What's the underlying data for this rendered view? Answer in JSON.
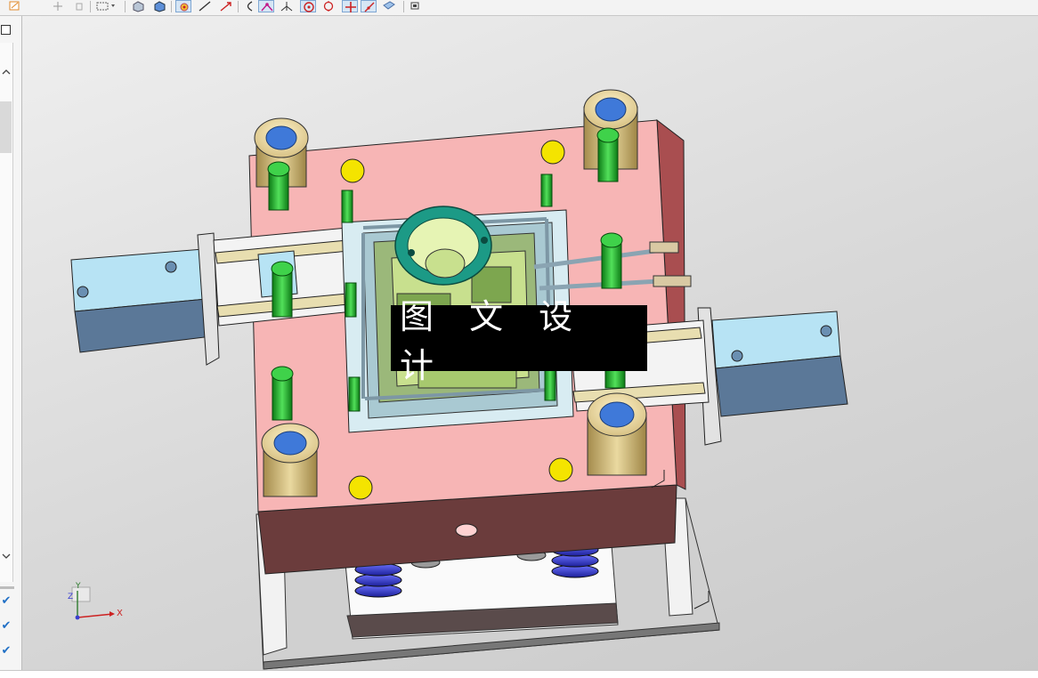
{
  "app": {
    "accent_color": "#1f6fc5",
    "toolbar_icons": [
      "shaded-view-icon",
      "wireframe-view-icon",
      "select-features-icon",
      "line-icon",
      "arrow-icon",
      "arc-icon",
      "snap-point-icon",
      "dimension-icon",
      "center-point-icon",
      "circle-snap-icon",
      "intersection-icon",
      "tangent-icon",
      "part-icon",
      "layer-icon"
    ]
  },
  "left_panel": {
    "scroll_up_icon": "chevron-up-icon",
    "scroll_down_icon": "chevron-down-icon",
    "check_marks": [
      "✔",
      "✔",
      "✔"
    ]
  },
  "viewport": {
    "watermark_text": "图 文 设 计",
    "triad": {
      "x_label": "X",
      "z_label": "Z",
      "y_label": "Y"
    },
    "model_colors": {
      "cavity_plate": "#f7b5b5",
      "plate_side": "#6b3c3c",
      "core_insert": "#cde3ea",
      "slider_blocks": "#b7e3f4",
      "screws": "#1fb62a",
      "guide_bushings": "#e8d7a2",
      "locating_ring": "#1c9a86",
      "ejector_pads": "#f4e400",
      "springs": "#3a3fd0"
    }
  }
}
